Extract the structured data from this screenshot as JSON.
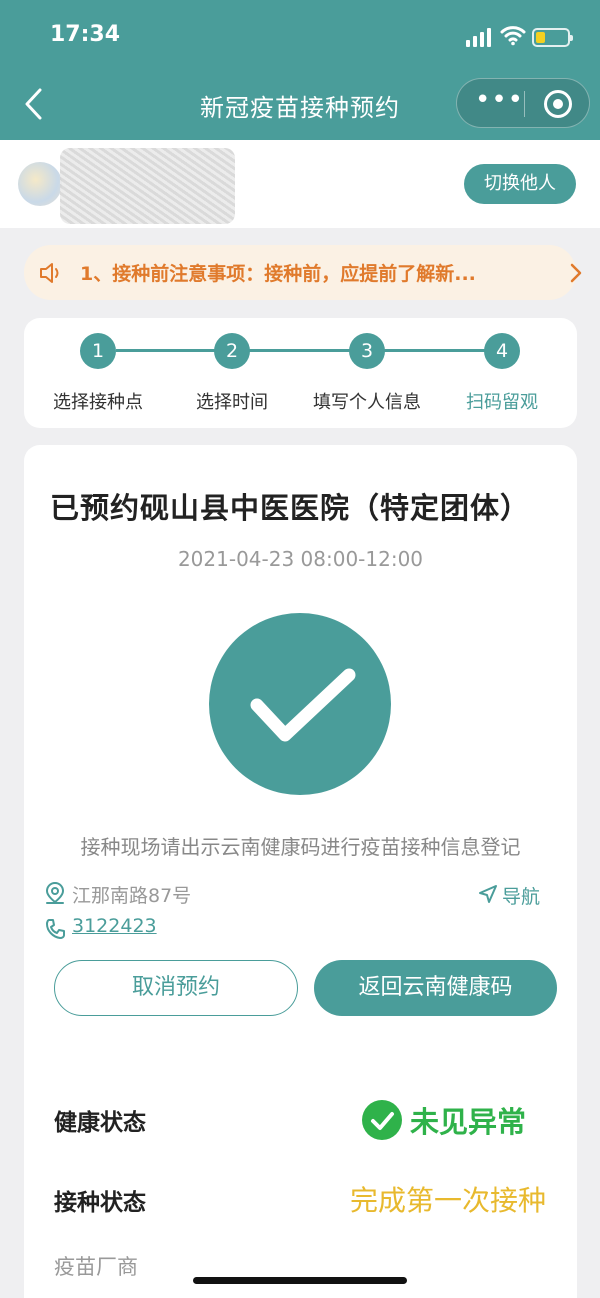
{
  "status_bar": {
    "time": "17:34"
  },
  "nav": {
    "title": "新冠疫苗接种预约"
  },
  "user": {
    "switch_label": "切换他人"
  },
  "notice": {
    "text": "1、接种前注意事项：接种前，应提前了解新..."
  },
  "steps": [
    {
      "num": "1",
      "label": "选择接种点"
    },
    {
      "num": "2",
      "label": "选择时间"
    },
    {
      "num": "3",
      "label": "填写个人信息"
    },
    {
      "num": "4",
      "label": "扫码留观"
    }
  ],
  "booking": {
    "title": "已预约砚山县中医医院（特定团体）",
    "datetime": "2021-04-23 08:00-12:00",
    "hint": "接种现场请出示云南健康码进行疫苗接种信息登记",
    "address": "江那南路87号",
    "navigate_label": "导航",
    "phone": "3122423",
    "cancel_label": "取消预约",
    "return_label": "返回云南健康码"
  },
  "status": {
    "health_label": "健康状态",
    "health_value": "未见异常",
    "vaccination_label": "接种状态",
    "vaccination_value": "完成第一次接种",
    "vendor_label": "疫苗厂商"
  },
  "colors": {
    "primary": "#4a9d9a",
    "notice_bg": "#fbf1e4",
    "notice_text": "#e07a2c",
    "health_green": "#2fb24a",
    "vaccination_yellow": "#e8b92e"
  }
}
